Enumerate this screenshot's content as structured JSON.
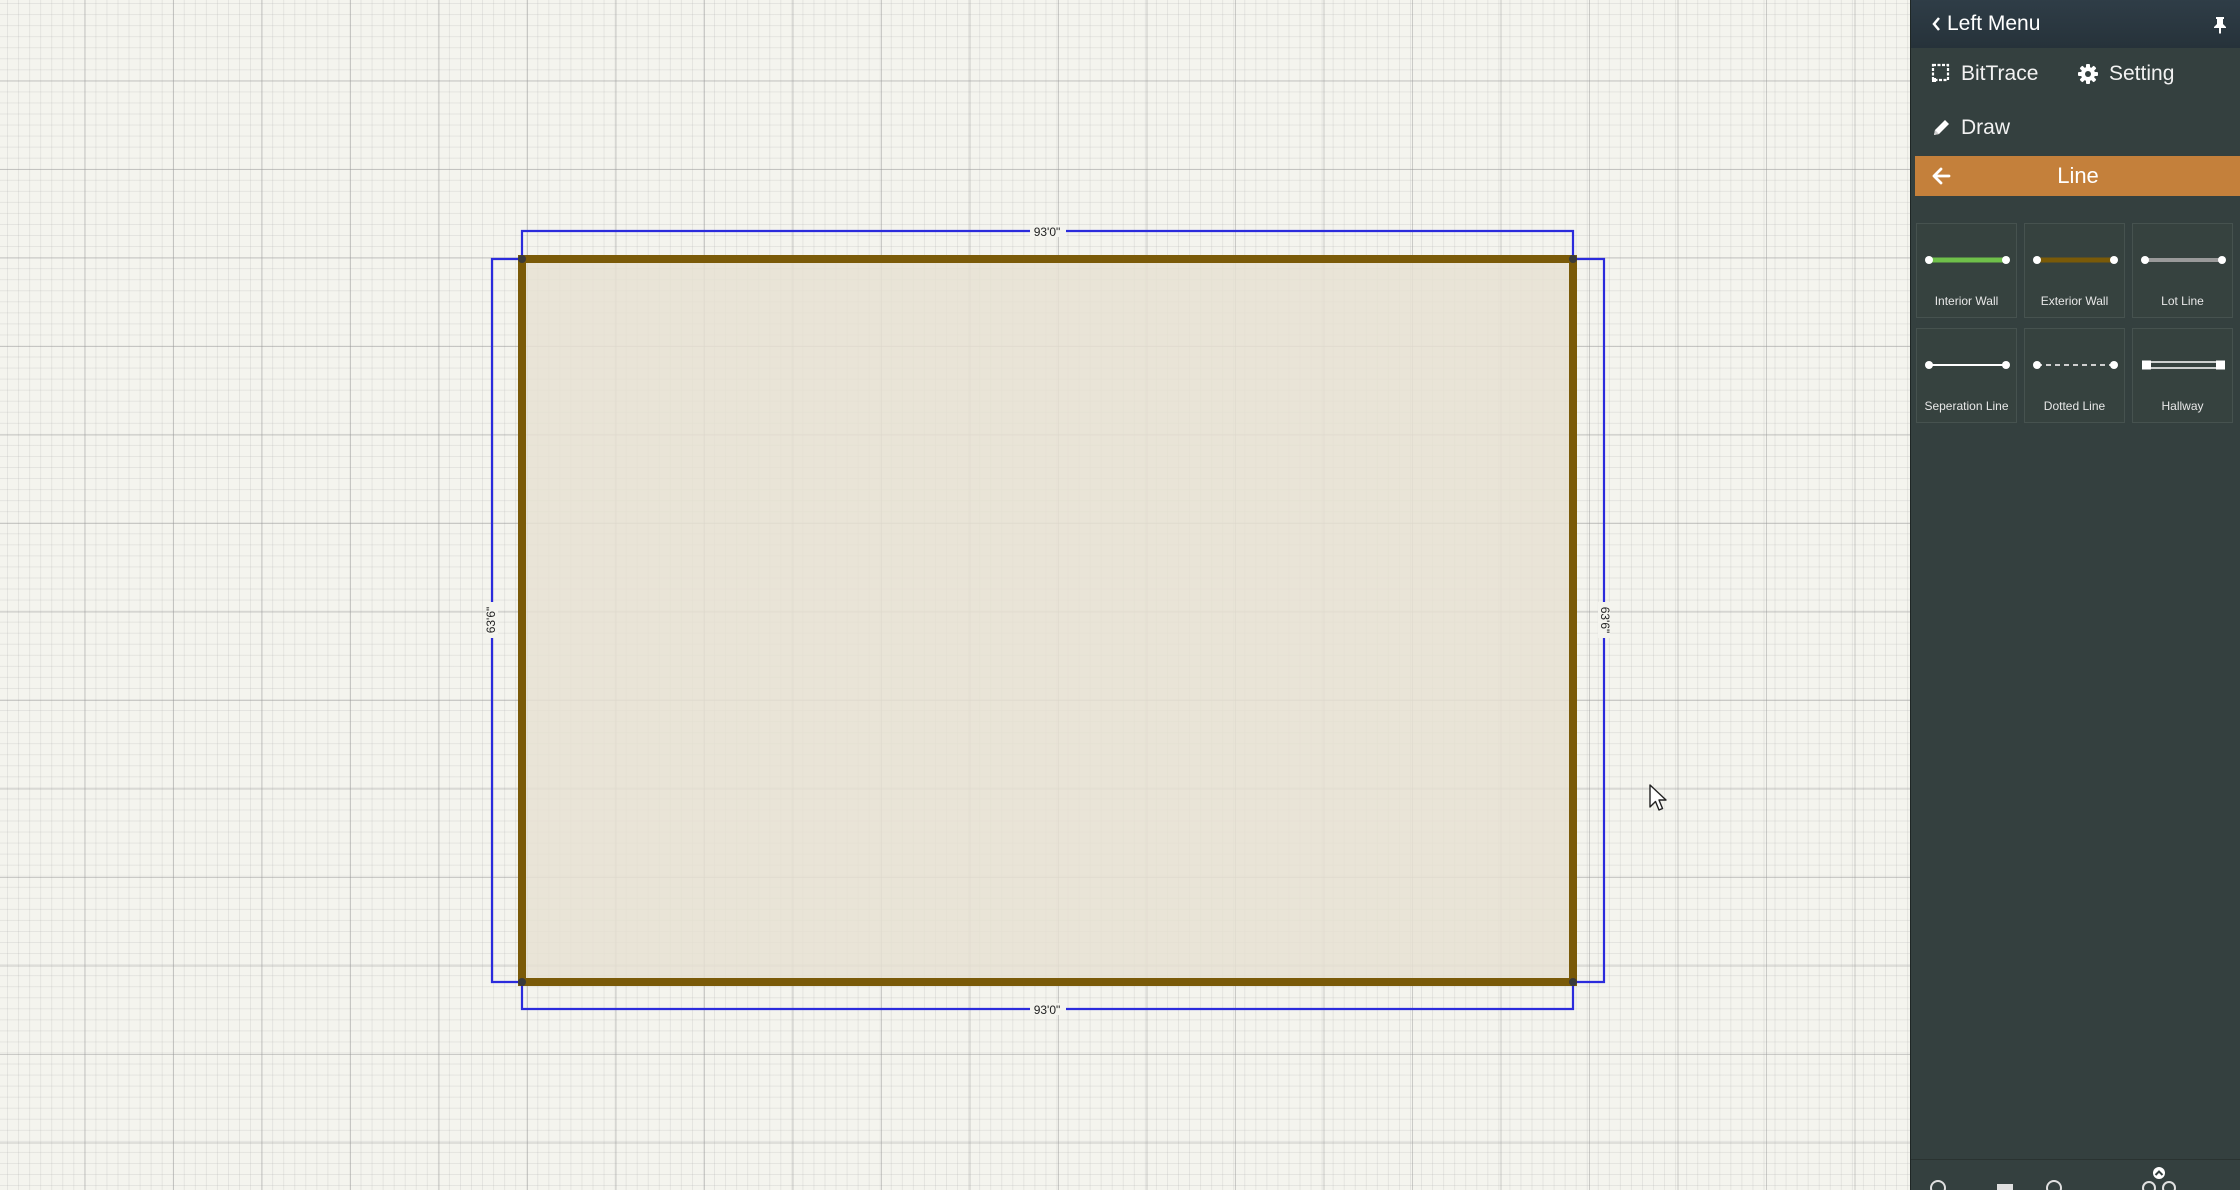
{
  "canvas": {
    "dimensions": {
      "top": "93'0\"",
      "bottom": "93'0\"",
      "left": "63'6\"",
      "right": "63'6\""
    },
    "colors": {
      "wall": "#7a5a08",
      "dimension_line": "#2b2bdc",
      "room_fill": "#e6e1d2"
    }
  },
  "left_menu": {
    "header": {
      "title": "Left Menu",
      "icons": [
        "chevron-left-icon",
        "pin-icon"
      ]
    },
    "items": [
      {
        "label": "BitTrace",
        "icon": "bittrace-icon"
      },
      {
        "label": "Setting",
        "icon": "gear-icon"
      },
      {
        "label": "Draw",
        "icon": "pencil-icon"
      }
    ],
    "section": {
      "title": "Line",
      "back_icon": "arrow-left-icon",
      "color": "#c4803b"
    },
    "line_types": [
      {
        "label": "Interior Wall",
        "color": "#6fc04a"
      },
      {
        "label": "Exterior Wall",
        "color": "#7a5a08"
      },
      {
        "label": "Lot Line",
        "color": "#9a9a9a"
      },
      {
        "label": "Seperation Line",
        "color": "#ffffff"
      },
      {
        "label": "Dotted Line",
        "color": "#cfcfcf"
      },
      {
        "label": "Hallway",
        "color": "#ffffff"
      }
    ]
  }
}
